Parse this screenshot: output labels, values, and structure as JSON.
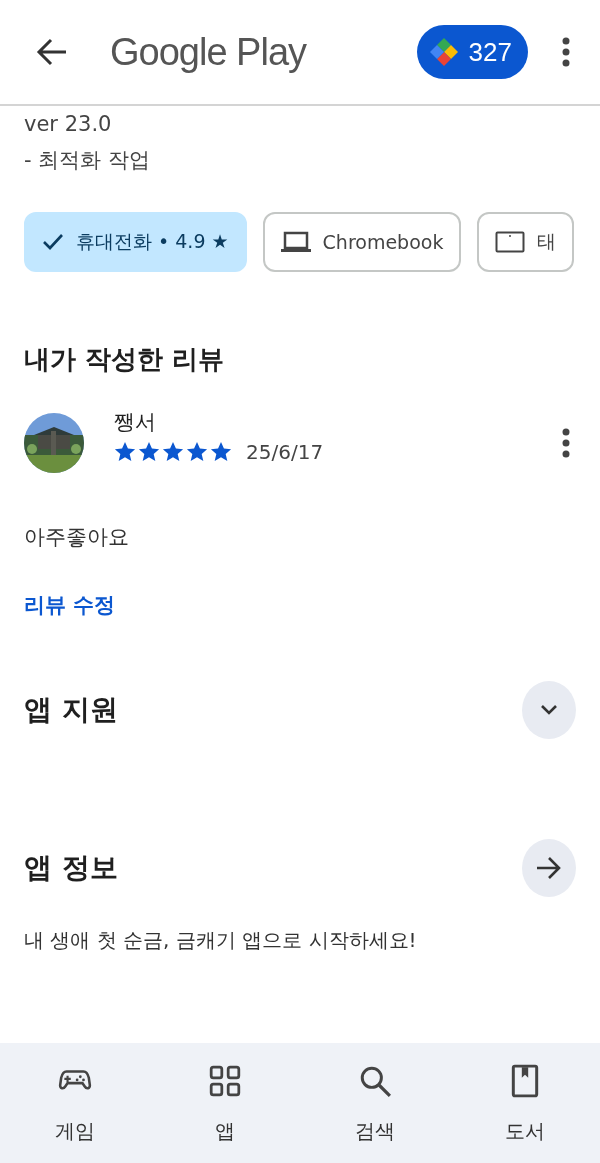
{
  "header": {
    "title": "Google Play",
    "points": "327"
  },
  "notes": [
    "ver 23.0",
    "- 최적화 작업"
  ],
  "device_chips": [
    {
      "label": "휴대전화 • 4.9 ★",
      "selected": true
    },
    {
      "label": "Chromebook",
      "selected": false,
      "kind": "laptop"
    },
    {
      "label": "태",
      "selected": false,
      "kind": "tablet"
    }
  ],
  "my_review": {
    "heading": "내가 작성한 리뷰",
    "author": "쨍서",
    "stars": 5,
    "date": "25/6/17",
    "text": "아주좋아요",
    "edit_link": "리뷰 수정"
  },
  "sections": [
    {
      "title": "앱 지원",
      "kind": "expand"
    },
    {
      "title": "앱 정보",
      "kind": "arrow",
      "description": "내 생애 첫 순금, 금캐기 앱으로 시작하세요!"
    }
  ],
  "bottom_nav": [
    {
      "label": "게임",
      "kind": "games",
      "selected": false
    },
    {
      "label": "앱",
      "kind": "apps",
      "selected": false
    },
    {
      "label": "검색",
      "kind": "search",
      "selected": false
    },
    {
      "label": "도서",
      "kind": "books",
      "selected": false
    }
  ]
}
